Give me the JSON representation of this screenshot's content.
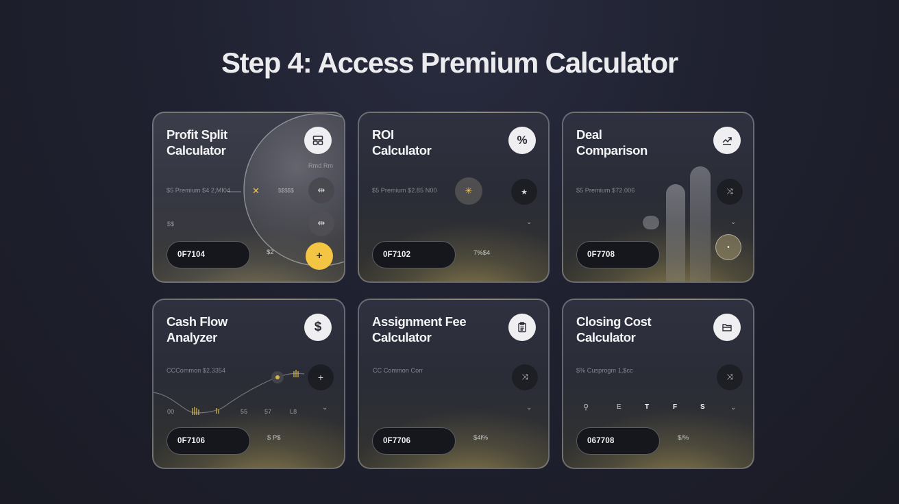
{
  "page": {
    "title": "Step 4: Access Premium Calculator"
  },
  "colors": {
    "background": "#1f2130",
    "accent_gold": "#f4c542",
    "card_border": "#c8c8cd",
    "pill_bg": "#16171c"
  },
  "cards": [
    {
      "title_line1": "Profit Split",
      "title_line2": "Calculator",
      "icon": "grid-icon",
      "muted_text": "$5 Premium $4 2,MI04",
      "slider_label": "Rmd Rm",
      "dial_value": "$$$$$",
      "side_mark": "$$",
      "code": "0F7104",
      "side_value": "$2",
      "action_icon": "plus-icon"
    },
    {
      "title_line1": "ROI",
      "title_line2": "Calculator",
      "icon": "percent-icon",
      "muted_text": "$5 Premium $2.85 N00",
      "code": "0F7102",
      "side_value": "7%$4"
    },
    {
      "title_line1": "Deal",
      "title_line2": "Comparison",
      "icon": "chart-icon",
      "muted_text": "$5 Premium $72.006",
      "code": "0F7708"
    },
    {
      "title_line1": "Cash Flow",
      "title_line2": "Analyzer",
      "icon": "dollar-icon",
      "muted_text": "CCCommon $2.3354",
      "axis_labels": [
        "00",
        "55",
        "57",
        "L8"
      ],
      "code": "0F7106",
      "side_value": "$ P$"
    },
    {
      "title_line1": "Assignment Fee",
      "title_line2": "Calculator",
      "icon": "clipboard-icon",
      "muted_text": "CC Common Corr",
      "code": "0F7706",
      "side_value": "$4l%"
    },
    {
      "title_line1": "Closing Cost",
      "title_line2": "Calculator",
      "icon": "folder-icon",
      "muted_text": "$% Cusprogm 1,$cc",
      "weekdays": [
        "E",
        "T",
        "F",
        "S"
      ],
      "code": "067708",
      "side_value": "$/%"
    }
  ]
}
